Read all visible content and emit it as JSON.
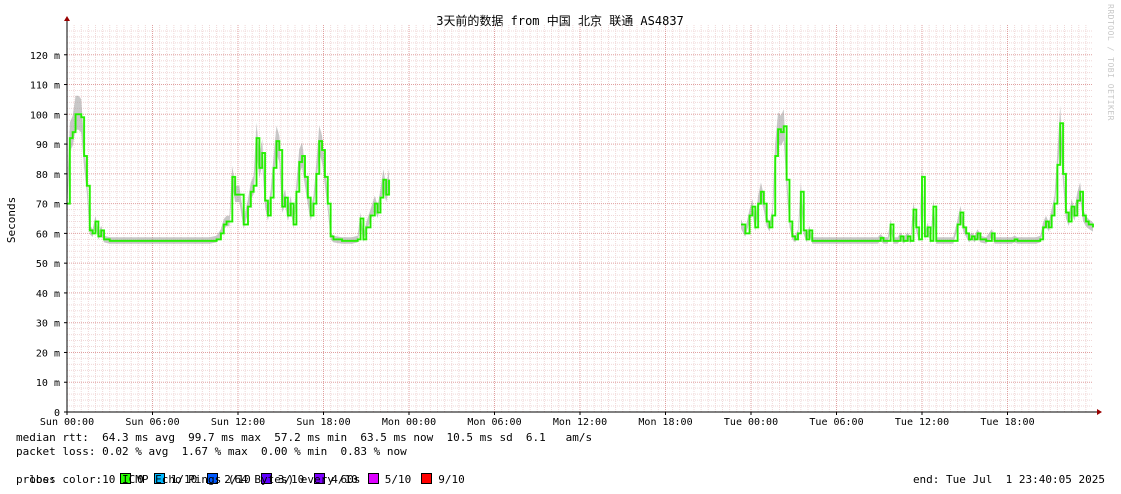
{
  "chart_data": {
    "type": "line",
    "title": "3天前的数据 from 中国 北京 联通 AS4837",
    "ylabel": "Seconds",
    "xlabel": "",
    "grid": true,
    "ylim": [
      0,
      130
    ],
    "y_tick_labels": [
      {
        "value": 0,
        "label": "0"
      },
      {
        "value": 10,
        "label": "10 m"
      },
      {
        "value": 20,
        "label": "20 m"
      },
      {
        "value": 30,
        "label": "30 m"
      },
      {
        "value": 40,
        "label": "40 m"
      },
      {
        "value": 50,
        "label": "50 m"
      },
      {
        "value": 60,
        "label": "60 m"
      },
      {
        "value": 70,
        "label": "70 m"
      },
      {
        "value": 80,
        "label": "80 m"
      },
      {
        "value": 90,
        "label": "90 m"
      },
      {
        "value": 100,
        "label": "100 m"
      },
      {
        "value": 110,
        "label": "110 m"
      },
      {
        "value": 120,
        "label": "120 m"
      }
    ],
    "x_range_hours": [
      0,
      72
    ],
    "x_tick_labels": [
      {
        "hour": 0,
        "label": "Sun 00:00"
      },
      {
        "hour": 6,
        "label": "Sun 06:00"
      },
      {
        "hour": 12,
        "label": "Sun 12:00"
      },
      {
        "hour": 18,
        "label": "Sun 18:00"
      },
      {
        "hour": 24,
        "label": "Mon 00:00"
      },
      {
        "hour": 30,
        "label": "Mon 06:00"
      },
      {
        "hour": 36,
        "label": "Mon 12:00"
      },
      {
        "hour": 42,
        "label": "Mon 18:00"
      },
      {
        "hour": 48,
        "label": "Tue 00:00"
      },
      {
        "hour": 54,
        "label": "Tue 06:00"
      },
      {
        "hour": 60,
        "label": "Tue 12:00"
      },
      {
        "hour": 66,
        "label": "Tue 18:00"
      }
    ],
    "series": [
      {
        "segment": 1,
        "points": [
          [
            0.0,
            70
          ],
          [
            0.2,
            92
          ],
          [
            0.4,
            94
          ],
          [
            0.6,
            100
          ],
          [
            0.8,
            100
          ],
          [
            1.0,
            99
          ],
          [
            1.2,
            86
          ],
          [
            1.4,
            76
          ],
          [
            1.6,
            61
          ],
          [
            1.8,
            60
          ],
          [
            2.0,
            64
          ],
          [
            2.2,
            59
          ],
          [
            2.4,
            61
          ],
          [
            2.6,
            58
          ],
          [
            3.0,
            57.5
          ],
          [
            5.0,
            57.5
          ],
          [
            8.0,
            57.5
          ],
          [
            10.0,
            57.5
          ],
          [
            10.5,
            58
          ],
          [
            10.8,
            60
          ],
          [
            11.0,
            63
          ],
          [
            11.2,
            64
          ],
          [
            11.4,
            64
          ],
          [
            11.6,
            79
          ],
          [
            11.8,
            73
          ],
          [
            12.1,
            73
          ],
          [
            12.4,
            63
          ],
          [
            12.7,
            69
          ],
          [
            12.9,
            74
          ],
          [
            13.1,
            76
          ],
          [
            13.3,
            92
          ],
          [
            13.5,
            82
          ],
          [
            13.7,
            87
          ],
          [
            13.9,
            71
          ],
          [
            14.1,
            66
          ],
          [
            14.3,
            72
          ],
          [
            14.5,
            82
          ],
          [
            14.7,
            91
          ],
          [
            14.9,
            88
          ],
          [
            15.1,
            69
          ],
          [
            15.3,
            72
          ],
          [
            15.5,
            66
          ],
          [
            15.7,
            70
          ],
          [
            15.9,
            63
          ],
          [
            16.1,
            74
          ],
          [
            16.3,
            84
          ],
          [
            16.5,
            86
          ],
          [
            16.7,
            79
          ],
          [
            16.9,
            72
          ],
          [
            17.1,
            66
          ],
          [
            17.3,
            70
          ],
          [
            17.5,
            80
          ],
          [
            17.7,
            91
          ],
          [
            17.9,
            88
          ],
          [
            18.1,
            79
          ],
          [
            18.3,
            70
          ],
          [
            18.5,
            59
          ],
          [
            18.7,
            58
          ],
          [
            19.3,
            57.5
          ],
          [
            20.0,
            57.5
          ],
          [
            20.4,
            58
          ],
          [
            20.6,
            65
          ],
          [
            20.8,
            58
          ],
          [
            21.0,
            62
          ],
          [
            21.3,
            66
          ],
          [
            21.6,
            70
          ],
          [
            21.8,
            67
          ],
          [
            22.0,
            72
          ],
          [
            22.2,
            78
          ],
          [
            22.4,
            73
          ],
          [
            22.6,
            78
          ]
        ]
      },
      {
        "segment": 2,
        "points": [
          [
            47.3,
            63
          ],
          [
            47.6,
            60
          ],
          [
            47.9,
            66
          ],
          [
            48.1,
            69
          ],
          [
            48.3,
            62
          ],
          [
            48.5,
            70
          ],
          [
            48.7,
            74
          ],
          [
            48.9,
            70
          ],
          [
            49.1,
            64
          ],
          [
            49.3,
            62
          ],
          [
            49.5,
            66
          ],
          [
            49.7,
            86
          ],
          [
            49.9,
            95
          ],
          [
            50.1,
            94
          ],
          [
            50.3,
            96
          ],
          [
            50.5,
            78
          ],
          [
            50.7,
            64
          ],
          [
            50.9,
            59
          ],
          [
            51.1,
            58
          ],
          [
            51.3,
            60
          ],
          [
            51.5,
            74
          ],
          [
            51.7,
            61
          ],
          [
            51.9,
            58
          ],
          [
            52.1,
            61
          ],
          [
            52.3,
            57.5
          ],
          [
            55.0,
            57.5
          ],
          [
            56.9,
            57.5
          ],
          [
            57.1,
            58.5
          ],
          [
            57.3,
            57.5
          ],
          [
            57.6,
            57.5
          ],
          [
            57.8,
            63
          ],
          [
            58.0,
            57.5
          ],
          [
            58.3,
            57.5
          ],
          [
            58.5,
            59
          ],
          [
            58.7,
            57.5
          ],
          [
            59.0,
            59
          ],
          [
            59.2,
            57.5
          ],
          [
            59.4,
            68
          ],
          [
            59.6,
            62
          ],
          [
            59.8,
            58
          ],
          [
            60.0,
            79
          ],
          [
            60.2,
            59
          ],
          [
            60.4,
            62
          ],
          [
            60.6,
            57.5
          ],
          [
            60.8,
            69
          ],
          [
            61.0,
            57.5
          ],
          [
            62.2,
            57.5
          ],
          [
            62.5,
            63
          ],
          [
            62.7,
            67
          ],
          [
            62.9,
            62
          ],
          [
            63.1,
            60
          ],
          [
            63.3,
            58
          ],
          [
            63.5,
            59
          ],
          [
            63.7,
            58
          ],
          [
            63.9,
            60
          ],
          [
            64.1,
            58
          ],
          [
            64.5,
            57.5
          ],
          [
            64.9,
            60
          ],
          [
            65.1,
            57.5
          ],
          [
            66.3,
            57.5
          ],
          [
            66.5,
            58
          ],
          [
            66.7,
            57.5
          ],
          [
            68.0,
            57.5
          ],
          [
            68.3,
            58
          ],
          [
            68.5,
            62
          ],
          [
            68.7,
            64
          ],
          [
            68.9,
            62
          ],
          [
            69.1,
            66
          ],
          [
            69.3,
            70
          ],
          [
            69.5,
            83
          ],
          [
            69.7,
            97
          ],
          [
            69.9,
            80
          ],
          [
            70.1,
            67
          ],
          [
            70.3,
            64
          ],
          [
            70.5,
            69
          ],
          [
            70.7,
            66
          ],
          [
            70.9,
            71
          ],
          [
            71.1,
            74
          ],
          [
            71.3,
            66
          ],
          [
            71.5,
            64
          ],
          [
            71.7,
            63
          ],
          [
            72.0,
            62
          ]
        ]
      }
    ]
  },
  "stats": {
    "median_rtt": "median rtt:  64.3 ms avg  99.7 ms max  57.2 ms min  63.5 ms now  10.5 ms sd  6.1   am/s",
    "packet_loss": "packet loss: 0.02 % avg  1.67 % max  0.00 % min  0.83 % now",
    "loss_color_label": "loss color:",
    "probe": "probe:       10 ICMP Echo Pings (64 Bytes) every 60s",
    "end_time": "end: Tue Jul  1 23:40:05 2025"
  },
  "loss_colors": [
    {
      "label": "0",
      "color": "#26ff00"
    },
    {
      "label": "1/10",
      "color": "#00b8ff"
    },
    {
      "label": "2/10",
      "color": "#0059ff"
    },
    {
      "label": "3/10",
      "color": "#5e00ff"
    },
    {
      "label": "4/10",
      "color": "#7e00ff"
    },
    {
      "label": "5/10",
      "color": "#dd00ff"
    },
    {
      "label": "9/10",
      "color": "#ff0000"
    }
  ],
  "watermark": "RRDTOOL / TOBI OETIKER"
}
